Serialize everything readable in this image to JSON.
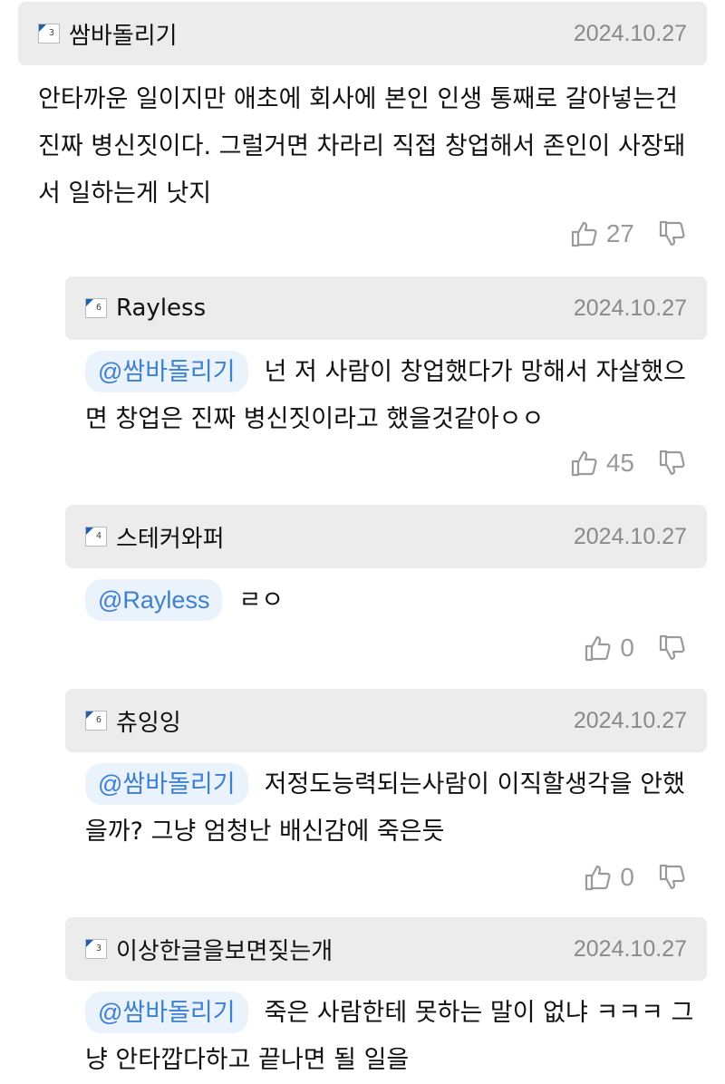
{
  "comments": [
    {
      "author": "쌈바돌리기",
      "level": "3",
      "date": "2024.10.27",
      "mention": "",
      "text": "안타까운 일이지만 애초에 회사에 본인 인생 통째로 갈아넣는건 진짜 병신짓이다. 그럴거면 차라리 직접 창업해서 존인이 사장돼서 일하는게 낫지",
      "likes": "27"
    },
    {
      "author": "Rayless",
      "level": "6",
      "date": "2024.10.27",
      "mention": "@쌈바돌리기",
      "text": "넌 저 사람이 창업했다가 망해서 자살했으면 창업은 진짜 병신짓이라고 했을것같아ㅇㅇ",
      "likes": "45"
    },
    {
      "author": "스테커와퍼",
      "level": "4",
      "date": "2024.10.27",
      "mention": "@Rayless",
      "text": "ㄹㅇ",
      "likes": "0"
    },
    {
      "author": "츄잉잉",
      "level": "6",
      "date": "2024.10.27",
      "mention": "@쌈바돌리기",
      "text": "저정도능력되는사람이 이직할생각을 안했을까? 그냥 엄청난 배신감에 죽은듯",
      "likes": "0"
    },
    {
      "author": "이상한글을보면짖는개",
      "level": "3",
      "date": "2024.10.27",
      "mention": "@쌈바돌리기",
      "text": "죽은 사람한테 못하는 말이 없냐 ㅋㅋㅋ 그냥 안타깝다하고 끝나면 될 일을"
    }
  ],
  "icons": {
    "like": "thumbs-up-icon",
    "dislike": "thumbs-down-icon",
    "level": "level-badge-icon"
  },
  "colors": {
    "mention_text": "#3d7fd1",
    "mention_bg": "#eaf2fb",
    "header_bg": "#ececec",
    "date": "#8a8a8a",
    "vote": "#9a9a9a",
    "level_flag": "#1f5fae"
  }
}
